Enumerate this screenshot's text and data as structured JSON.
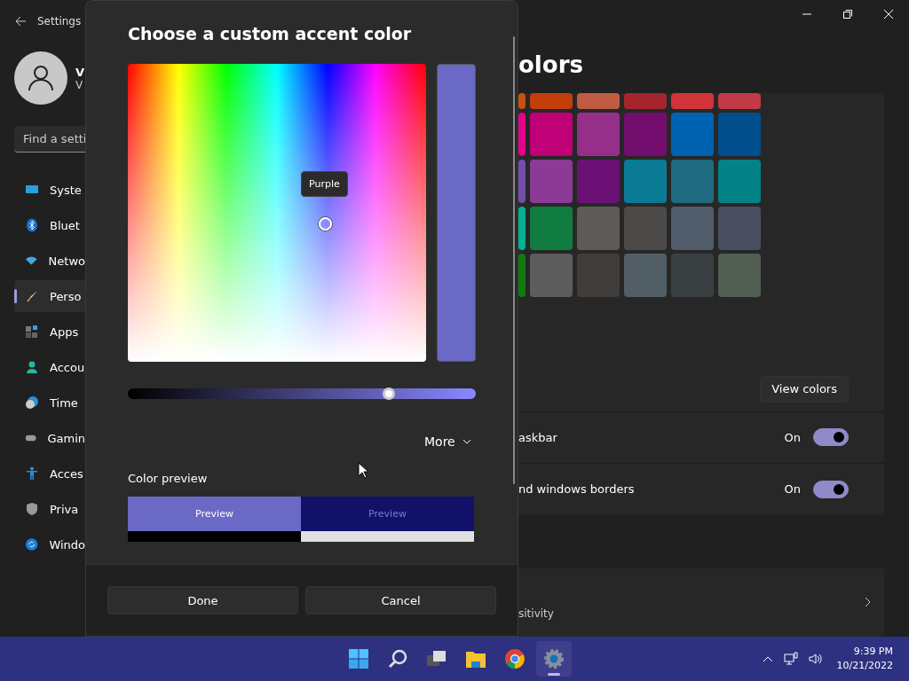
{
  "sidebar": {
    "app_title": "Settings",
    "user": {
      "name": "V",
      "email": "V"
    },
    "search": {
      "placeholder": "Find a setti"
    },
    "items": [
      {
        "label": "Syste",
        "selected": false
      },
      {
        "label": "Bluet",
        "selected": false
      },
      {
        "label": "Netwo",
        "selected": false
      },
      {
        "label": "Perso",
        "selected": true
      },
      {
        "label": "Apps",
        "selected": false
      },
      {
        "label": "Accou",
        "selected": false
      },
      {
        "label": "Time",
        "selected": false
      },
      {
        "label": "Gamin",
        "selected": false
      },
      {
        "label": "Acces",
        "selected": false
      },
      {
        "label": "Priva",
        "selected": false
      },
      {
        "label": "Windo",
        "selected": false
      }
    ]
  },
  "dialog": {
    "title": "Choose a custom accent color",
    "tooltip": "Purple",
    "brightness": {
      "level": 0.75
    },
    "more": "More",
    "preview_heading": "Color preview",
    "previews": [
      {
        "label": "Preview",
        "color": "#6b69c6"
      },
      {
        "label": "Preview",
        "color": "#11116a"
      }
    ],
    "buttons": [
      "Done",
      "Cancel"
    ]
  },
  "page": {
    "title": "olors",
    "swatches": [
      {
        "color": "#ca5010"
      },
      {
        "color": "#c43e0a"
      },
      {
        "color": "#c15b42"
      },
      {
        "color": "#a4262c"
      },
      {
        "color": "#d13438"
      },
      {
        "color": "#c23a45"
      },
      {
        "color": "#e3008c"
      },
      {
        "color": "#bf0077"
      },
      {
        "color": "#962f8a"
      },
      {
        "color": "#740e6e"
      },
      {
        "color": "#0063b1"
      },
      {
        "color": "#004e8c"
      },
      {
        "color": "#744da9"
      },
      {
        "color": "#8b3a96"
      },
      {
        "color": "#6b1176"
      },
      {
        "color": "#0a7a95"
      },
      {
        "color": "#1f6b80"
      },
      {
        "color": "#038387"
      },
      {
        "color": "#00b294"
      },
      {
        "color": "#107c41"
      },
      {
        "color": "#5d5a58"
      },
      {
        "color": "#4c4a48"
      },
      {
        "color": "#515c6b"
      },
      {
        "color": "#4a5060"
      },
      {
        "color": "#107c10"
      },
      {
        "color": "#5c5c5c"
      },
      {
        "color": "#403d3b"
      },
      {
        "color": "#525e66"
      },
      {
        "color": "#3b4043"
      },
      {
        "color": "#525e54"
      }
    ],
    "view_colors_button": "View colors",
    "toggles": [
      {
        "label": "askbar",
        "state_text": "On",
        "on": true
      },
      {
        "label": "nd windows borders",
        "state_text": "On",
        "on": true
      }
    ],
    "link_row": {
      "label": "sitivity"
    }
  },
  "taskbar": {
    "apps": [
      {
        "kind": "start",
        "selected": false
      },
      {
        "kind": "search",
        "selected": false
      },
      {
        "kind": "task-view",
        "selected": false
      },
      {
        "kind": "files",
        "selected": false
      },
      {
        "kind": "browser",
        "selected": false
      },
      {
        "kind": "settings",
        "selected": true
      }
    ],
    "clock": {
      "time": "9:39 PM",
      "date": "10/21/2022"
    }
  }
}
